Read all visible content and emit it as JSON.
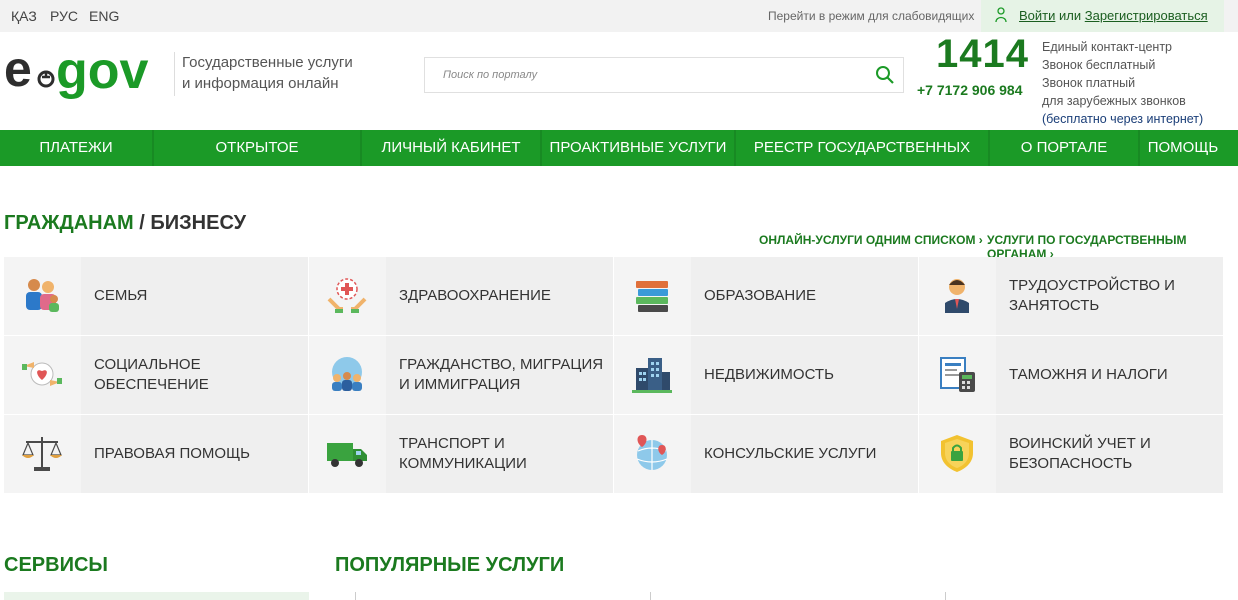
{
  "topbar": {
    "languages": [
      "ҚАЗ",
      "РУС",
      "ENG"
    ],
    "vision_mode": "Перейти в режим для слабовидящих",
    "login": "Войти",
    "or": "или",
    "register": "Зарегистрироваться"
  },
  "header": {
    "tagline_1": "Государственные услуги",
    "tagline_2": "и информация онлайн",
    "search_placeholder": "Поиск по порталу",
    "phone_short": "1414",
    "phone_long": "+7 7172 906 984",
    "contact_center": "Единый контакт-центр",
    "call_free": "Звонок бесплатный",
    "call_paid": "Звонок платный",
    "foreign_calls": "для зарубежных звонков",
    "free_internet": "(бесплатно через интернет)"
  },
  "nav": {
    "items": [
      "ПЛАТЕЖИ",
      "ОТКРЫТОЕ ПРАВИТЕЛЬСТВО",
      "ЛИЧНЫЙ КАБИНЕТ",
      "ПРОАКТИВНЫЕ УСЛУГИ",
      "РЕЕСТР ГОСУДАРСТВЕННЫХ УСЛУГ",
      "О ПОРТАЛЕ",
      "ПОМОЩЬ"
    ]
  },
  "services": {
    "title_citizens": "ГРАЖДАНАМ",
    "title_sep": "/",
    "title_business": "БИЗНЕСУ",
    "link_online": "ОНЛАЙН-УСЛУГИ ОДНИМ СПИСКОМ ›",
    "link_agencies": "УСЛУГИ ПО ГОСУДАРСТВЕННЫМ ОРГАНАМ ›",
    "tiles": [
      {
        "label": "СЕМЬЯ",
        "icon": "family-icon"
      },
      {
        "label": "ЗДРАВООХРАНЕНИЕ",
        "icon": "healthcare-icon"
      },
      {
        "label": "ОБРАЗОВАНИЕ",
        "icon": "books-icon"
      },
      {
        "label": "ТРУДОУСТРОЙСТВО И ЗАНЯТОСТЬ",
        "icon": "employee-icon"
      },
      {
        "label": "СОЦИАЛЬНОЕ ОБЕСПЕЧЕНИЕ",
        "icon": "social-care-icon"
      },
      {
        "label": "ГРАЖДАНСТВО, МИГРАЦИЯ И ИММИГРАЦИЯ",
        "icon": "globe-people-icon"
      },
      {
        "label": "НЕДВИЖИМОСТЬ",
        "icon": "buildings-icon"
      },
      {
        "label": "ТАМОЖНЯ И НАЛОГИ",
        "icon": "tax-calculator-icon"
      },
      {
        "label": "ПРАВОВАЯ ПОМОЩЬ",
        "icon": "scales-icon"
      },
      {
        "label": "ТРАНСПОРТ И КОММУНИКАЦИИ",
        "icon": "truck-icon"
      },
      {
        "label": "КОНСУЛЬСКИЕ УСЛУГИ",
        "icon": "globe-pin-icon"
      },
      {
        "label": "ВОИНСКИЙ УЧЕТ И БЕЗОПАСНОСТЬ",
        "icon": "shield-lock-icon"
      }
    ]
  },
  "bottom": {
    "services_title": "СЕРВИСЫ",
    "popular_title": "ПОПУЛЯРНЫЕ УСЛУГИ"
  },
  "colors": {
    "brand_green": "#1b9a27",
    "dark_green": "#1b7a1f",
    "tile_bg": "#efefef"
  }
}
